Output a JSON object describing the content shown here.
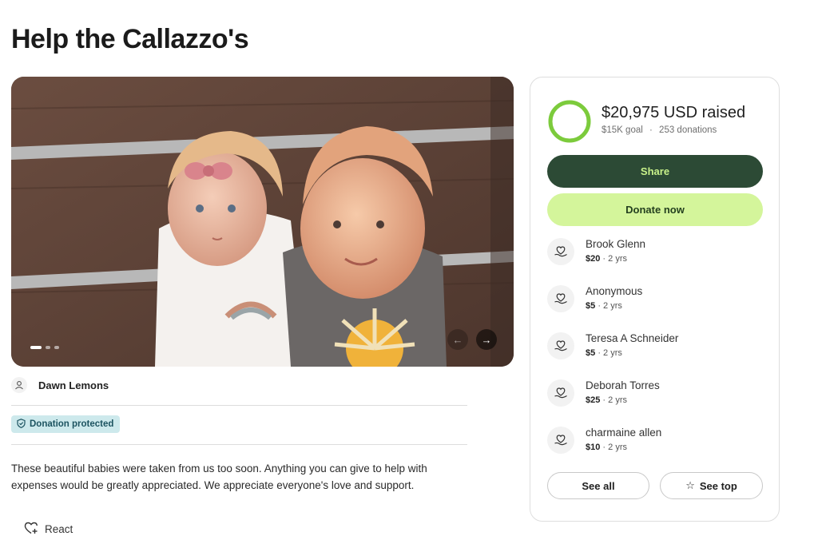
{
  "page": {
    "title": "Help the Callazzo's"
  },
  "photo": {
    "slide_count": 3,
    "active_slide": 1,
    "subject": "two toddlers sitting against a wooden fence",
    "prev_icon": "arrow-left",
    "next_icon": "arrow-right"
  },
  "organizer": {
    "name": "Dawn Lemons",
    "icon": "person-icon"
  },
  "badge": {
    "label": "Donation protected",
    "icon": "shield-icon"
  },
  "description": "These beautiful babies were taken from us too soon. Anything you can give to help with expenses would be greatly appreciated. We appreciate everyone's love and support.",
  "react": {
    "label": "React",
    "icon": "heart-plus-icon"
  },
  "fundraiser": {
    "raised": "$20,975 USD raised",
    "goal": "$15K goal",
    "separator": "·",
    "donations": "253 donations",
    "progress_fraction": 1.0,
    "share_label": "Share",
    "donate_label": "Donate now",
    "donors": [
      {
        "name": "Brook Glenn",
        "amount": "$20",
        "time": "· 2 yrs"
      },
      {
        "name": "Anonymous",
        "amount": "$5",
        "time": "· 2 yrs"
      },
      {
        "name": "Teresa A Schneider",
        "amount": "$5",
        "time": "· 2 yrs"
      },
      {
        "name": "Deborah Torres",
        "amount": "$25",
        "time": "· 2 yrs"
      },
      {
        "name": "charmaine allen",
        "amount": "$10",
        "time": "· 2 yrs"
      }
    ],
    "see_all_label": "See all",
    "see_top_label": "See top",
    "see_top_icon": "star-icon"
  },
  "colors": {
    "share_bg": "#2c4a35",
    "share_text": "#c9f28a",
    "donate_bg": "#d4f59b",
    "progress": "#7ccb3c",
    "badge_bg": "#cde9ec"
  }
}
